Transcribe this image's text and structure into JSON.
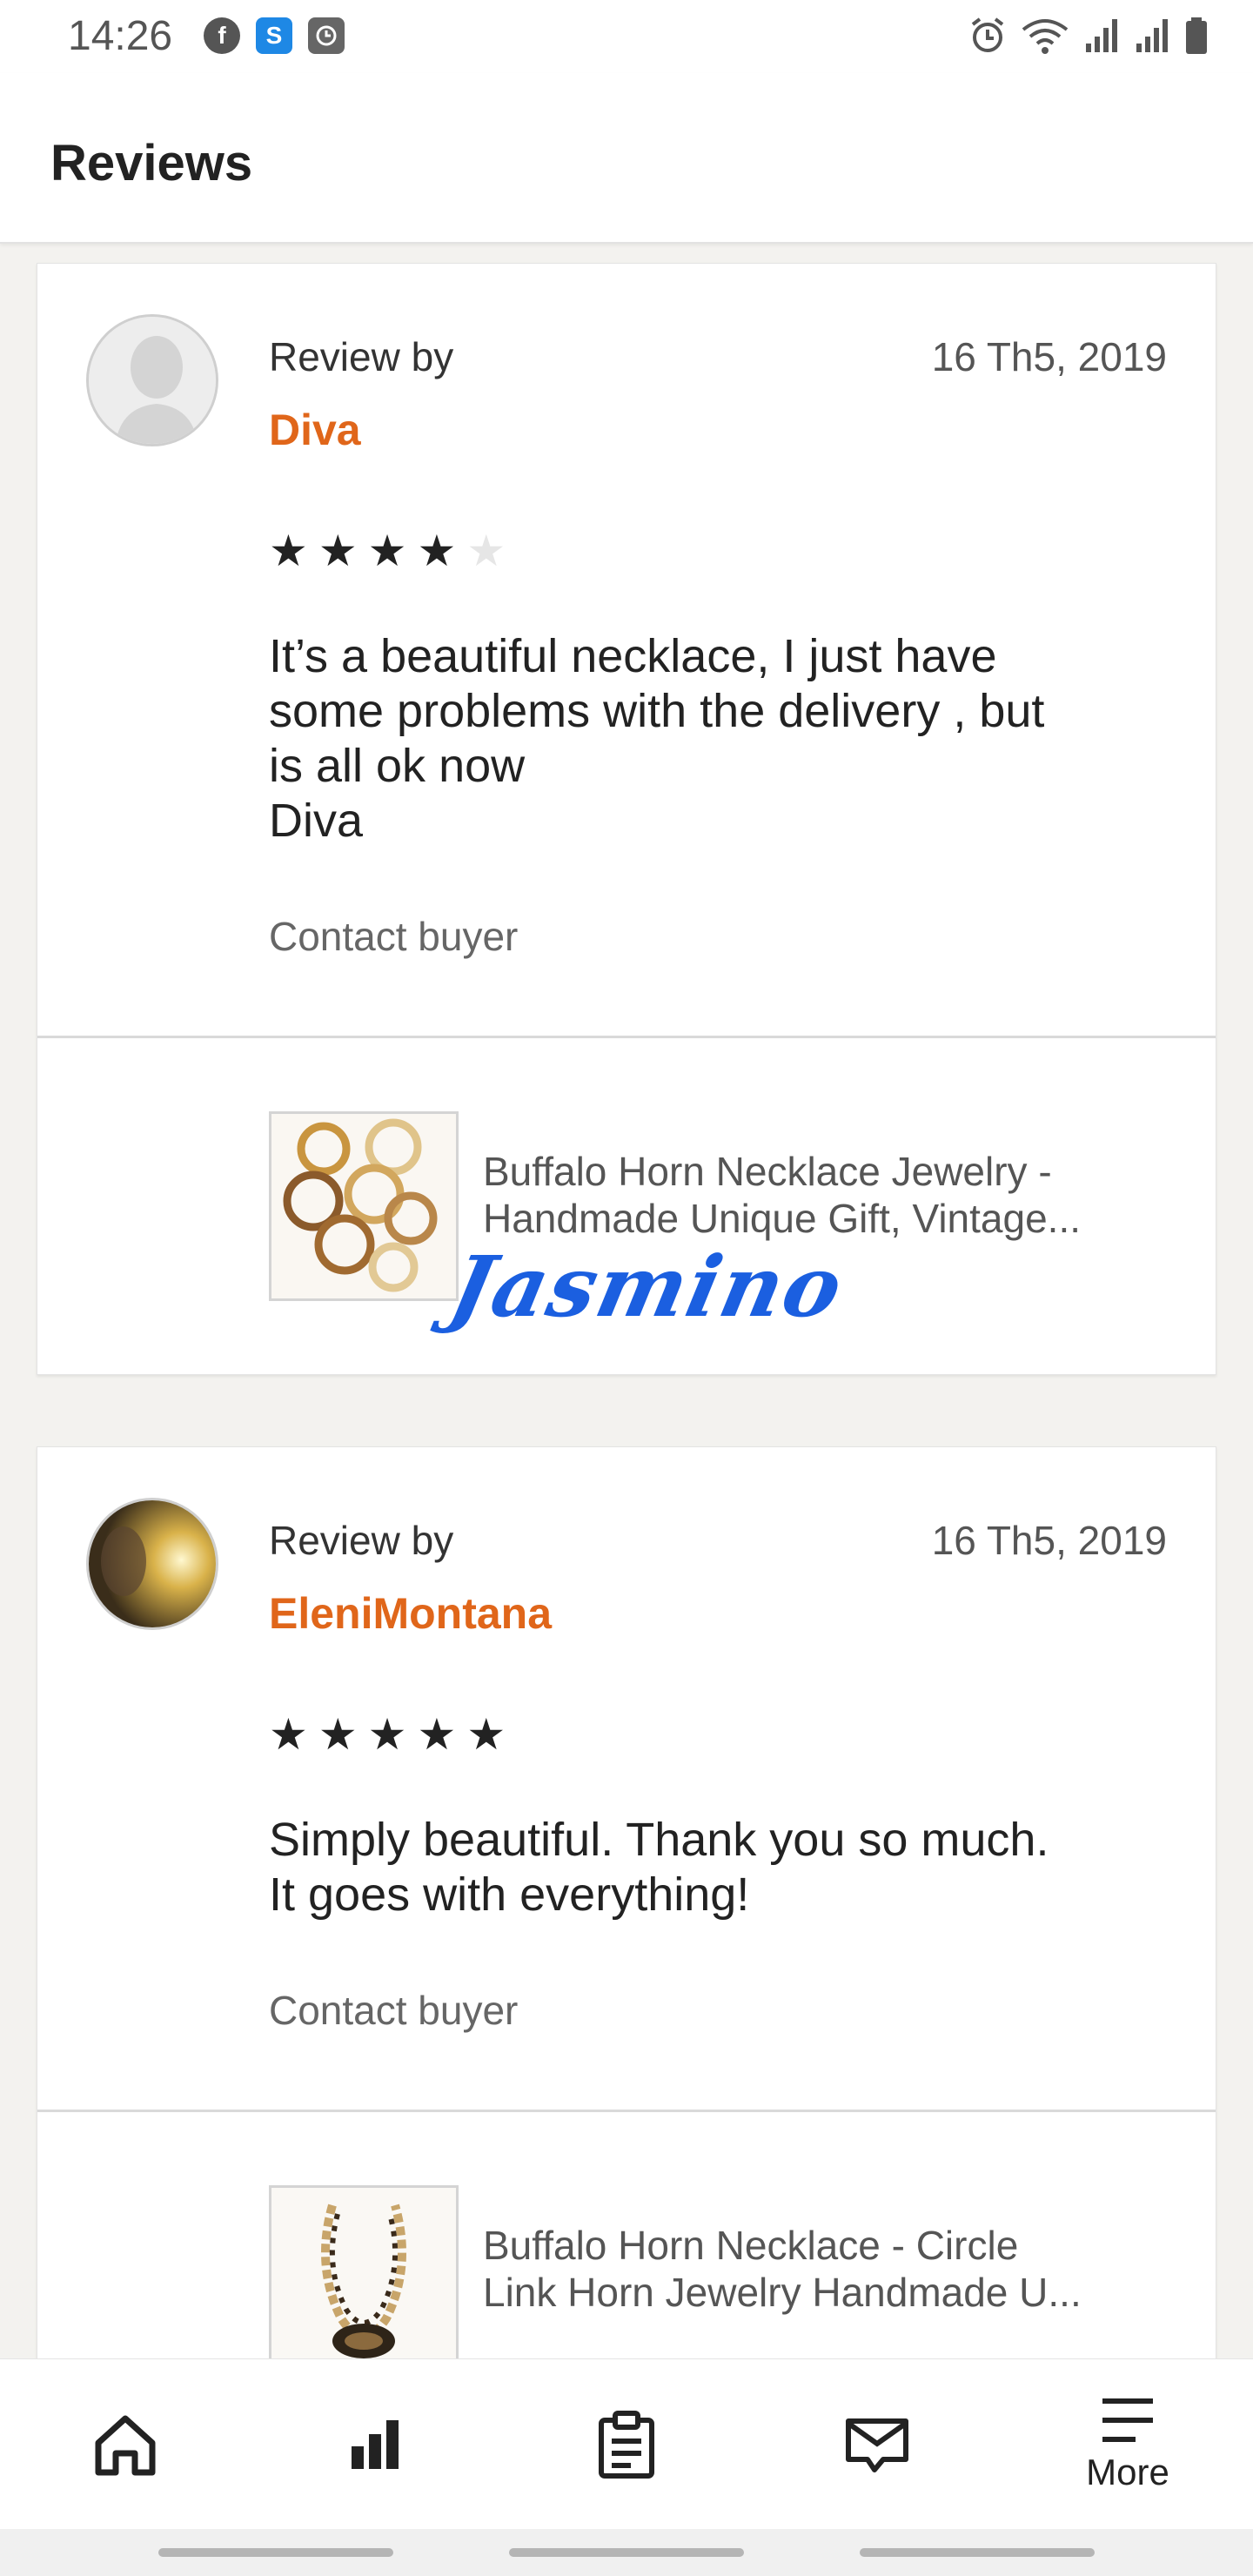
{
  "status": {
    "time": "14:26",
    "left_icons": [
      "facebook-icon",
      "s-app-icon",
      "clock-app-icon"
    ],
    "right_icons": [
      "alarm-icon",
      "wifi-icon",
      "signal-icon",
      "signal-icon",
      "battery-icon"
    ]
  },
  "header": {
    "title": "Reviews"
  },
  "reviews": [
    {
      "review_by_label": "Review by",
      "reviewer": "Diva",
      "date": "16 Th5, 2019",
      "rating": 4,
      "max_rating": 5,
      "text": "It’s a beautiful necklace, I just have\nsome problems with the delivery , but\nis all ok now\nDiva",
      "contact_label": "Contact buyer",
      "product": {
        "line1": "Buffalo Horn Necklace Jewelry -",
        "line2": "Handmade Unique Gift, Vintage..."
      }
    },
    {
      "review_by_label": "Review by",
      "reviewer": "EleniMontana",
      "date": "16 Th5, 2019",
      "rating": 5,
      "max_rating": 5,
      "text": "Simply beautiful. Thank you so much.\nIt goes with everything!",
      "contact_label": "Contact buyer",
      "product": {
        "line1": "Buffalo Horn Necklace - Circle",
        "line2": "Link Horn Jewelry Handmade U..."
      }
    }
  ],
  "signature": "Jasmino",
  "nav": {
    "items": [
      {
        "icon": "home-icon",
        "label": ""
      },
      {
        "icon": "stats-icon",
        "label": ""
      },
      {
        "icon": "orders-icon",
        "label": ""
      },
      {
        "icon": "messages-icon",
        "label": ""
      },
      {
        "icon": "menu-icon",
        "label": "More"
      }
    ]
  },
  "colors": {
    "accent": "#e0661a",
    "signature": "#1b5fe0",
    "background": "#f3f2ef"
  }
}
